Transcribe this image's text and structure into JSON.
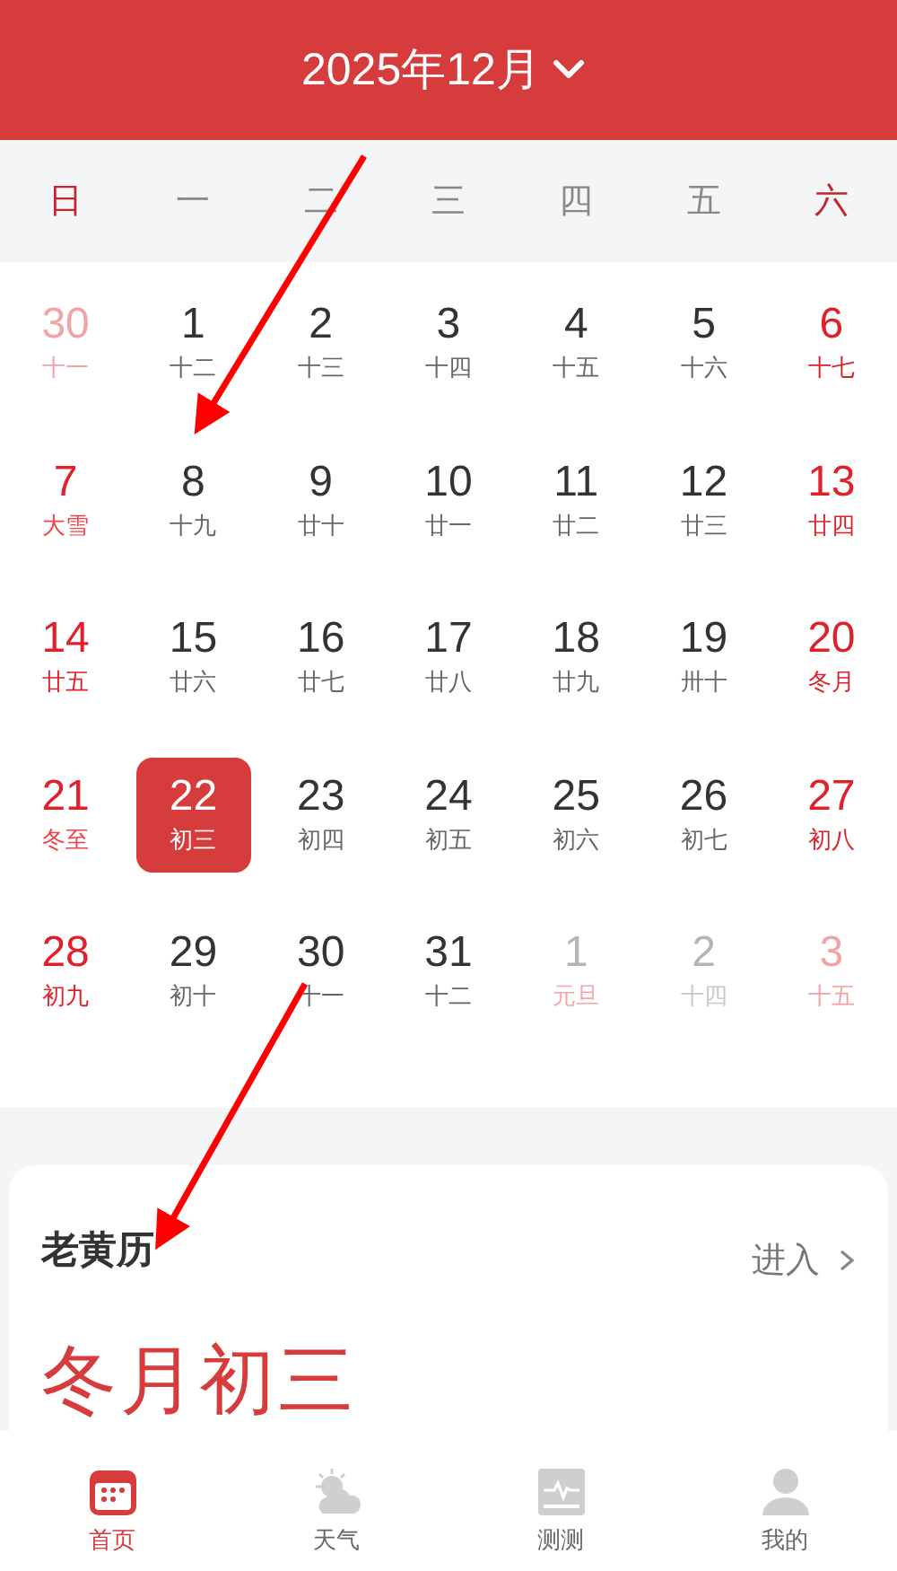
{
  "header": {
    "month": "2025年12月"
  },
  "weekdays": [
    {
      "label": "日",
      "weekend": true
    },
    {
      "label": "一",
      "weekend": false
    },
    {
      "label": "二",
      "weekend": false
    },
    {
      "label": "三",
      "weekend": false
    },
    {
      "label": "四",
      "weekend": false
    },
    {
      "label": "五",
      "weekend": false
    },
    {
      "label": "六",
      "weekend": true
    }
  ],
  "days": [
    {
      "day": "30",
      "lunar": "十一",
      "weekend": true,
      "other_month": true,
      "festival": false,
      "selected": false
    },
    {
      "day": "1",
      "lunar": "十二",
      "weekend": false,
      "other_month": false,
      "festival": false,
      "selected": false
    },
    {
      "day": "2",
      "lunar": "十三",
      "weekend": false,
      "other_month": false,
      "festival": false,
      "selected": false
    },
    {
      "day": "3",
      "lunar": "十四",
      "weekend": false,
      "other_month": false,
      "festival": false,
      "selected": false
    },
    {
      "day": "4",
      "lunar": "十五",
      "weekend": false,
      "other_month": false,
      "festival": false,
      "selected": false
    },
    {
      "day": "5",
      "lunar": "十六",
      "weekend": false,
      "other_month": false,
      "festival": false,
      "selected": false
    },
    {
      "day": "6",
      "lunar": "十七",
      "weekend": true,
      "other_month": false,
      "festival": false,
      "selected": false
    },
    {
      "day": "7",
      "lunar": "大雪",
      "weekend": true,
      "other_month": false,
      "festival": true,
      "selected": false
    },
    {
      "day": "8",
      "lunar": "十九",
      "weekend": false,
      "other_month": false,
      "festival": false,
      "selected": false
    },
    {
      "day": "9",
      "lunar": "廿十",
      "weekend": false,
      "other_month": false,
      "festival": false,
      "selected": false
    },
    {
      "day": "10",
      "lunar": "廿一",
      "weekend": false,
      "other_month": false,
      "festival": false,
      "selected": false
    },
    {
      "day": "11",
      "lunar": "廿二",
      "weekend": false,
      "other_month": false,
      "festival": false,
      "selected": false
    },
    {
      "day": "12",
      "lunar": "廿三",
      "weekend": false,
      "other_month": false,
      "festival": false,
      "selected": false
    },
    {
      "day": "13",
      "lunar": "廿四",
      "weekend": true,
      "other_month": false,
      "festival": false,
      "selected": false
    },
    {
      "day": "14",
      "lunar": "廿五",
      "weekend": true,
      "other_month": false,
      "festival": false,
      "selected": false
    },
    {
      "day": "15",
      "lunar": "廿六",
      "weekend": false,
      "other_month": false,
      "festival": false,
      "selected": false
    },
    {
      "day": "16",
      "lunar": "廿七",
      "weekend": false,
      "other_month": false,
      "festival": false,
      "selected": false
    },
    {
      "day": "17",
      "lunar": "廿八",
      "weekend": false,
      "other_month": false,
      "festival": false,
      "selected": false
    },
    {
      "day": "18",
      "lunar": "廿九",
      "weekend": false,
      "other_month": false,
      "festival": false,
      "selected": false
    },
    {
      "day": "19",
      "lunar": "卅十",
      "weekend": false,
      "other_month": false,
      "festival": false,
      "selected": false
    },
    {
      "day": "20",
      "lunar": "冬月",
      "weekend": true,
      "other_month": false,
      "festival": false,
      "selected": false
    },
    {
      "day": "21",
      "lunar": "冬至",
      "weekend": true,
      "other_month": false,
      "festival": true,
      "selected": false
    },
    {
      "day": "22",
      "lunar": "初三",
      "selected": true
    },
    {
      "day": "23",
      "lunar": "初四",
      "weekend": false,
      "other_month": false,
      "festival": false,
      "selected": false
    },
    {
      "day": "24",
      "lunar": "初五",
      "weekend": false,
      "other_month": false,
      "festival": false,
      "selected": false
    },
    {
      "day": "25",
      "lunar": "初六",
      "weekend": false,
      "other_month": false,
      "festival": false,
      "selected": false
    },
    {
      "day": "26",
      "lunar": "初七",
      "weekend": false,
      "other_month": false,
      "festival": false,
      "selected": false
    },
    {
      "day": "27",
      "lunar": "初八",
      "weekend": true,
      "other_month": false,
      "festival": false,
      "selected": false
    },
    {
      "day": "28",
      "lunar": "初九",
      "weekend": true,
      "other_month": false,
      "festival": false,
      "selected": false
    },
    {
      "day": "29",
      "lunar": "初十",
      "weekend": false,
      "other_month": false,
      "festival": false,
      "selected": false
    },
    {
      "day": "30",
      "lunar": "十一",
      "weekend": false,
      "other_month": false,
      "festival": false,
      "selected": false
    },
    {
      "day": "31",
      "lunar": "十二",
      "weekend": false,
      "other_month": false,
      "festival": false,
      "selected": false
    },
    {
      "day": "1",
      "lunar": "元旦",
      "weekend": false,
      "other_month": true,
      "festival": true,
      "selected": false
    },
    {
      "day": "2",
      "lunar": "十四",
      "weekend": false,
      "other_month": true,
      "festival": false,
      "selected": false
    },
    {
      "day": "3",
      "lunar": "十五",
      "weekend": true,
      "other_month": true,
      "festival": false,
      "selected": false
    }
  ],
  "almanac": {
    "title": "老黄历",
    "link": "进入",
    "date": "冬月初三"
  },
  "nav": [
    {
      "kind": "calendar",
      "label": "首页",
      "selected": true
    },
    {
      "kind": "weather",
      "label": "天气",
      "selected": false
    },
    {
      "kind": "monitor",
      "label": "测测",
      "selected": false
    },
    {
      "kind": "profile",
      "label": "我的",
      "selected": false
    }
  ]
}
